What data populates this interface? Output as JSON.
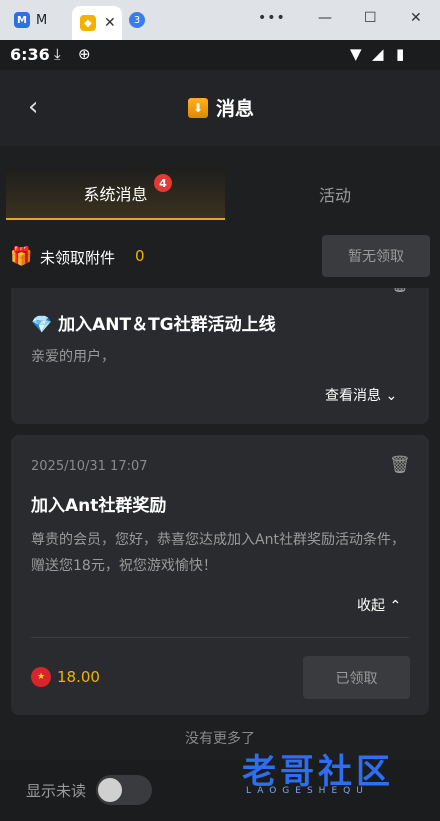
{
  "browser": {
    "tab1_label": "M",
    "tab1_icon": "M",
    "tab2_icon": "◆",
    "tab2_close": "✕",
    "tab_count": "3",
    "more": "•••",
    "minimize": "—",
    "maximize": "☐",
    "close": "✕"
  },
  "status": {
    "time": "6:36",
    "icons": [
      "download-icon",
      "sync-icon",
      "wifi-icon",
      "signal-icon",
      "battery-icon"
    ]
  },
  "header": {
    "title": "消息",
    "back": "‹"
  },
  "tabs": {
    "system_label": "系统消息",
    "system_badge": "4",
    "activity_label": "活动"
  },
  "attachments": {
    "label": "未领取附件",
    "count": "0",
    "claim_button": "暂无领取"
  },
  "messages": [
    {
      "title": "💎 加入ANT＆TG社群活动上线",
      "body": "亲爱的用户，",
      "toggle": "查看消息"
    },
    {
      "date": "2025/10/31 17:07",
      "title": "加入Ant社群奖励",
      "body": "尊贵的会员，您好，恭喜您达成加入Ant社群奖励活动条件，赠送您18元，祝您游戏愉快！",
      "toggle": "收起",
      "amount": "18.00",
      "claimed_button": "已领取"
    }
  ],
  "footer": {
    "no_more": "没有更多了",
    "show_unread": "显示未读",
    "show_unread_on": false
  },
  "watermark": {
    "text": "老哥社区",
    "sub": "LAOGESHEQU"
  },
  "colors": {
    "accent": "#e0a92a",
    "amount": "#f0b400",
    "badge": "#e53935",
    "background": "#1e1f21",
    "card": "#2a2b2e"
  }
}
